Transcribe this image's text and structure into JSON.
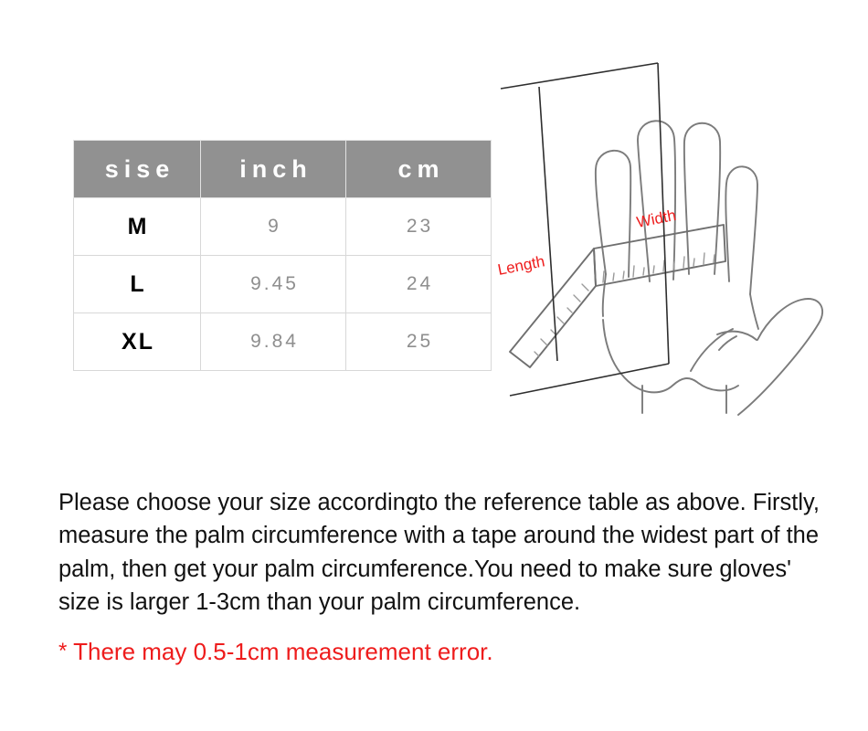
{
  "size_chart": {
    "columns": [
      "sise",
      "inch",
      "cm"
    ],
    "rows": [
      {
        "size": "M",
        "inch": "9",
        "cm": "23"
      },
      {
        "size": "L",
        "inch": "9.45",
        "cm": "24"
      },
      {
        "size": "XL",
        "inch": "9.84",
        "cm": "25"
      }
    ]
  },
  "diagram": {
    "length_label": "Length",
    "width_label": "Width",
    "label_color": "#ee1c1c",
    "outline_color": "#777777",
    "guide_color": "#333333"
  },
  "instructions": {
    "text": "Please choose your size accordingto the reference table as above. Firstly, measure the palm circumference with a tape around the widest part of the palm, then get your palm circumference.You need to make sure gloves' size is larger 1-3cm than your palm circumference."
  },
  "error_note": {
    "asterisk": "*",
    "text": "There may 0.5-1cm measurement error.",
    "color": "#ee1c1c"
  },
  "chart_data": {
    "type": "table",
    "title": "Glove size reference table",
    "columns": [
      "sise",
      "inch",
      "cm"
    ],
    "rows": [
      [
        "M",
        "9",
        "23"
      ],
      [
        "L",
        "9.45",
        "24"
      ],
      [
        "XL",
        "9.84",
        "25"
      ]
    ]
  }
}
